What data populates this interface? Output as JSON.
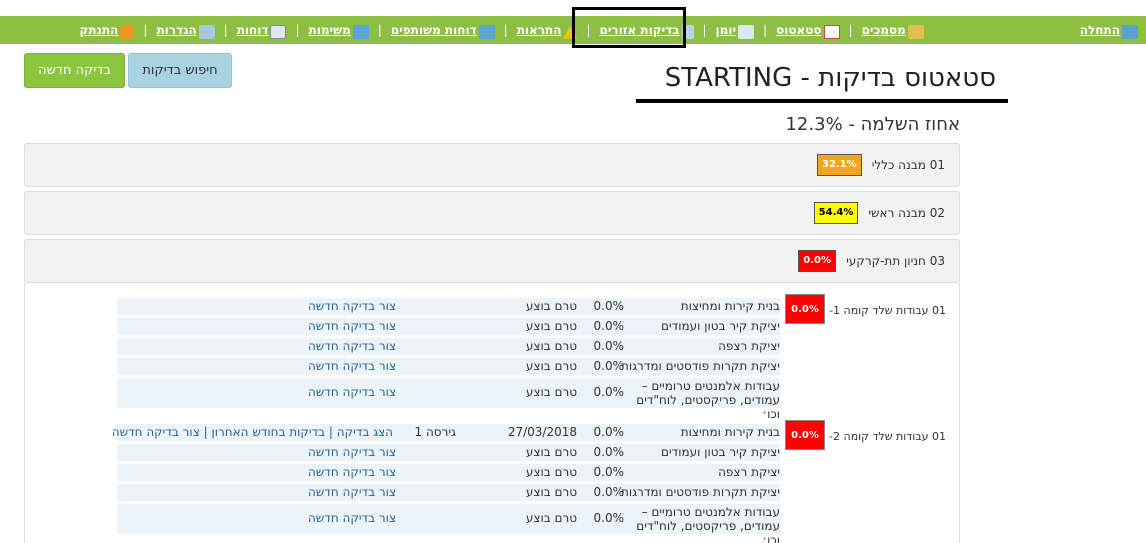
{
  "nav": {
    "items": [
      {
        "label": "התחלה",
        "icon": "home-icon"
      },
      {
        "label": "מסמכים",
        "icon": "documents-icon"
      },
      {
        "label": "סטאטוס",
        "icon": "calendar-icon"
      },
      {
        "label": "יומן",
        "icon": "journal-icon"
      },
      {
        "label": "בדיקות אזורים",
        "icon": "area-icon"
      },
      {
        "label": "התראות",
        "icon": "warning-icon"
      },
      {
        "label": "דוחות משותפים",
        "icon": "shared-reports-icon"
      },
      {
        "label": "משימות",
        "icon": "tasks-icon"
      },
      {
        "label": "דוחות",
        "icon": "printer-icon"
      },
      {
        "label": "הגדרות",
        "icon": "settings-icon"
      },
      {
        "label": "התנתק",
        "icon": "logout-icon"
      }
    ]
  },
  "buttons": {
    "search": "חיפוש בדיקות",
    "new": "בדיקה חדשה"
  },
  "page": {
    "title": "סטאטוס בדיקות - STARTING",
    "completion": "אחוז השלמה - 12.3%"
  },
  "sections": [
    {
      "label": "01 מבנה כללי",
      "pct": "32.1%",
      "color": "#f7a31c"
    },
    {
      "label": "02 מבנה ראשי",
      "pct": "54.4%",
      "color": "#ffff00"
    },
    {
      "label": "03 חניון תת-קרקעי",
      "pct": "0.0%",
      "color": "#ff0000"
    }
  ],
  "groups": [
    {
      "label": "01 עבודות שלד קומה 1-",
      "pct": "0.0%",
      "rows": [
        {
          "name": "בנית קירות ומחיצות",
          "pct": "0.0%",
          "date": "טרם בוצע",
          "round": "",
          "action": "צור בדיקה חדשה"
        },
        {
          "name": "יציקת קיר בטון ועמודים",
          "pct": "0.0%",
          "date": "טרם בוצע",
          "round": "",
          "action": "צור בדיקה חדשה"
        },
        {
          "name": "יציקת רצפה",
          "pct": "0.0%",
          "date": "טרם בוצע",
          "round": "",
          "action": "צור בדיקה חדשה"
        },
        {
          "name": "יציקת תקרות פודסטים ומדרגות",
          "pct": "0.0%",
          "date": "טרם בוצע",
          "round": "",
          "action": "צור בדיקה חדשה"
        },
        {
          "name": "עבודות אלמנטים טרומיים – עמודים, פריקסטים, לוח\"דים וכו׳",
          "pct": "0.0%",
          "date": "טרם בוצע",
          "round": "",
          "action": "צור בדיקה חדשה"
        }
      ]
    },
    {
      "label": "01 עבודות שלד קומה 2-",
      "pct": "0.0%",
      "rows": [
        {
          "name": "בנית קירות ומחיצות",
          "pct": "0.0%",
          "date": "27/03/2018",
          "round": "גירסה 1",
          "action": "הצג בדיקה | בדיקות בחודש האחרון | צור בדיקה חדשה"
        },
        {
          "name": "יציקת קיר בטון ועמודים",
          "pct": "0.0%",
          "date": "טרם בוצע",
          "round": "",
          "action": "צור בדיקה חדשה"
        },
        {
          "name": "יציקת רצפה",
          "pct": "0.0%",
          "date": "טרם בוצע",
          "round": "",
          "action": "צור בדיקה חדשה"
        },
        {
          "name": "יציקת תקרות פודסטים ומדרגות",
          "pct": "0.0%",
          "date": "טרם בוצע",
          "round": "",
          "action": "צור בדיקה חדשה"
        },
        {
          "name": "עבודות אלמנטים טרומיים – עמודים, פריקסטים, לוח\"דים וכו׳",
          "pct": "0.0%",
          "date": "טרם בוצע",
          "round": "",
          "action": "צור בדיקה חדשה"
        }
      ]
    }
  ]
}
